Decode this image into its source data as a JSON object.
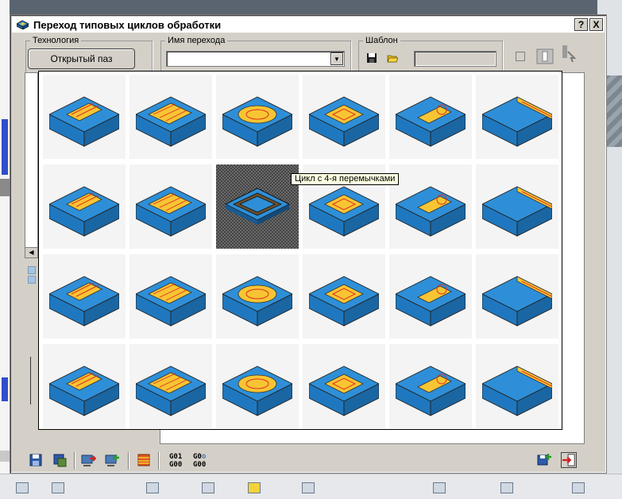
{
  "window": {
    "title": "Переход типовых циклов обработки",
    "help_label": "?",
    "close_label": "X"
  },
  "technology": {
    "legend": "Технология",
    "button_label": "Открытый паз"
  },
  "transition_name": {
    "legend": "Имя перехода",
    "value": ""
  },
  "template": {
    "legend": "Шаблон",
    "value": ""
  },
  "tooltip": "Цикл с 4-я перемычками",
  "cycles_grid": {
    "columns": 6,
    "rows": 4,
    "selected_index": 8,
    "items": [
      {
        "icon": "open-slot-icon"
      },
      {
        "icon": "multi-pass-slot-icon"
      },
      {
        "icon": "closed-pocket-icon"
      },
      {
        "icon": "slot-with-dims-icon"
      },
      {
        "icon": "slot-contour-icon"
      },
      {
        "icon": "step-slot-icon"
      },
      {
        "icon": "groove-icon"
      },
      {
        "icon": "open-pocket-icon"
      },
      {
        "icon": "four-bridge-cycle-icon"
      },
      {
        "icon": "surface-pocket-icon"
      },
      {
        "icon": "round-hole-icon"
      },
      {
        "icon": "u-pocket-icon"
      },
      {
        "icon": "multi-boss-icon"
      },
      {
        "icon": "curved-wall-icon"
      },
      {
        "icon": "chamfer-icon"
      },
      {
        "icon": "ring-groove-icon"
      },
      {
        "icon": "cylinder-flat-icon"
      },
      {
        "icon": "rib-icon"
      },
      {
        "icon": "inclined-pocket-icon"
      },
      {
        "icon": "boss-contour-icon"
      },
      {
        "icon": "bore-icon"
      },
      {
        "icon": "narrow-slot-icon"
      },
      {
        "icon": "cylinder-top-icon"
      },
      {
        "icon": "wall-face-icon"
      }
    ]
  },
  "toolbar": {
    "gcode_a": {
      "line1": "G01",
      "line2": "G00"
    },
    "gcode_b": {
      "line1": "G0",
      "line2": "G00"
    }
  },
  "colors": {
    "part_blue": "#2e8fd8",
    "machined_yellow": "#f7c533",
    "toolpath_red": "#e03020",
    "dialog_gray": "#d4d0c8"
  }
}
